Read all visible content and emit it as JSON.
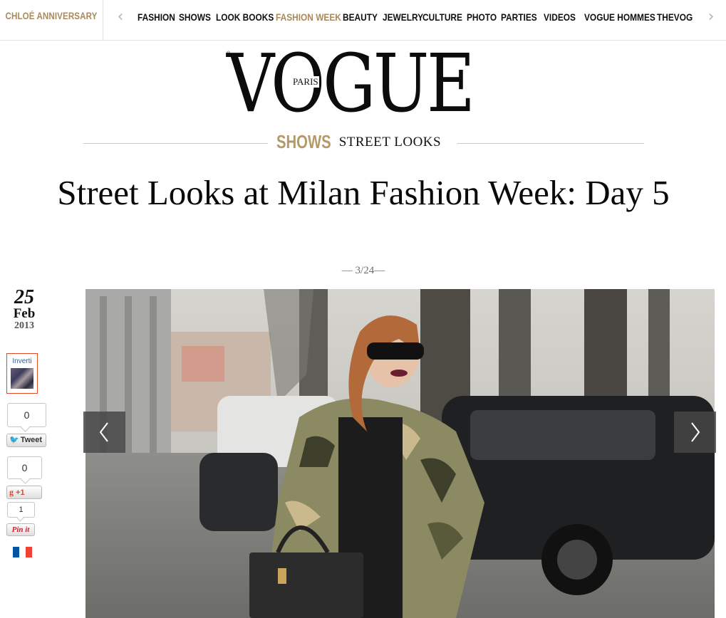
{
  "topnav": {
    "promo": "CHLOÉ ANNIVERSARY",
    "items": [
      {
        "label": "FASHION",
        "active": false
      },
      {
        "label": "SHOWS",
        "active": false
      },
      {
        "label": "LOOK BOOKS",
        "active": false
      },
      {
        "label": "FASHION WEEK",
        "active": true
      },
      {
        "label": "BEAUTY",
        "active": false
      },
      {
        "label": "JEWELRY",
        "active": false
      },
      {
        "label": "CULTURE",
        "active": false
      },
      {
        "label": "PHOTO",
        "active": false
      },
      {
        "label": "PARTIES",
        "active": false
      },
      {
        "label": "VIDEOS",
        "active": false
      },
      {
        "label": "VOGUE HOMMES",
        "active": false
      },
      {
        "label": "THEVOG",
        "active": false
      }
    ],
    "prev_icon": "chevron-left-icon",
    "next_icon": "chevron-right-icon"
  },
  "logo": {
    "brand": "VOGUE",
    "sub": "PARIS"
  },
  "section": {
    "category": "SHOWS",
    "subcategory": "STREET LOOKS"
  },
  "article": {
    "title": "Street Looks at Milan Fashion Week: Day 5",
    "counter": "— 3/24—"
  },
  "date": {
    "day": "25",
    "month": "Feb",
    "year": "2013"
  },
  "social": {
    "invert_label": "Inverti",
    "tweet_count": "0",
    "tweet_label": "Tweet",
    "gplus_count": "0",
    "gplus_label": "+1",
    "pin_count": "1",
    "pin_label": "Pin it",
    "flag_icon": "france-flag-icon"
  },
  "colors": {
    "accent": "#a88a5c",
    "section_accent": "#b49a68",
    "invert_border": "#e04a25",
    "tweet_bird": "#3aa2e5",
    "gplus": "#d6492f",
    "pinterest": "#c8232c",
    "flag_blue": "#0055a4",
    "flag_white": "#ffffff",
    "flag_red": "#ef4135"
  },
  "gallery": {
    "prev_icon": "chevron-left-icon",
    "next_icon": "chevron-right-icon"
  }
}
